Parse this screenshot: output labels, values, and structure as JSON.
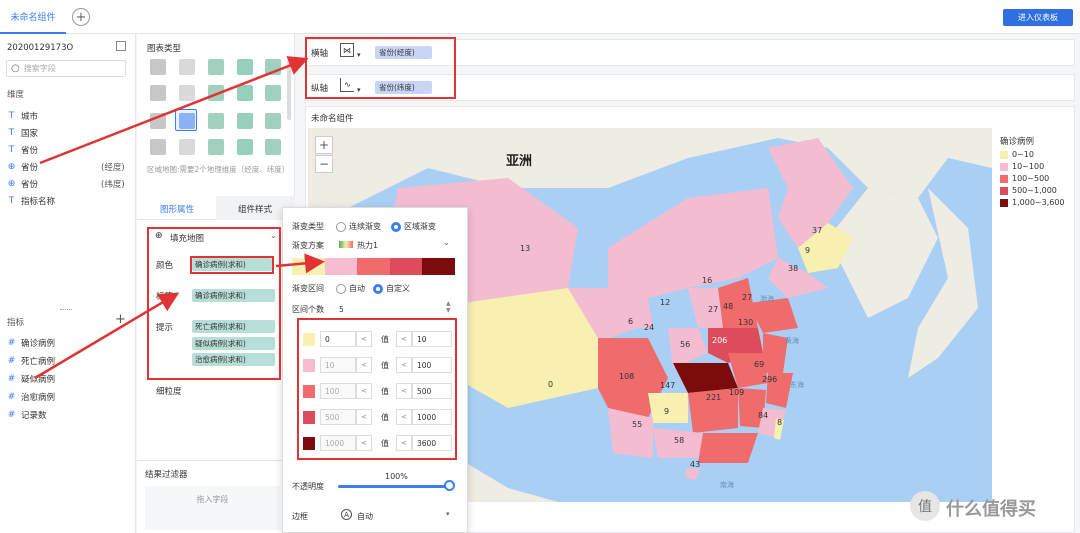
{
  "topbar": {
    "tab_label": "未命名组件",
    "add_tab": "+",
    "enter_dashboard": "进入仪表板"
  },
  "data_panel": {
    "dataset": "20200129173O",
    "search_placeholder": "搜索字段",
    "dimension_title": "维度",
    "dimensions": [
      {
        "icon": "T",
        "label": "城市",
        "suffix": ""
      },
      {
        "icon": "T",
        "label": "国家",
        "suffix": ""
      },
      {
        "icon": "T",
        "label": "省份",
        "suffix": ""
      },
      {
        "icon": "globe",
        "label": "省份",
        "suffix": "(经度)"
      },
      {
        "icon": "globe",
        "label": "省份",
        "suffix": "(纬度)"
      },
      {
        "icon": "T",
        "label": "指标名称",
        "suffix": ""
      }
    ],
    "metric_title": "指标",
    "metrics": [
      "确诊病例",
      "死亡病例",
      "疑似病例",
      "治愈病例",
      "记录数"
    ]
  },
  "chart_panel": {
    "title": "图表类型",
    "hint": "区域地图:需要2个地理维度（经度、纬度）",
    "tab_graphic": "图形属性",
    "tab_style": "组件样式",
    "map_type": "填充地图",
    "color_label": "颜色",
    "color_field": "确诊病例(求和)",
    "label_label": "标签",
    "label_field": "确诊病例(求和)",
    "tooltip_label": "提示",
    "tooltip_fields": [
      "死亡病例(求和)",
      "疑似病例(求和)",
      "治愈病例(求和)"
    ],
    "granularity": "细粒度",
    "filter_title": "结果过滤器",
    "filter_drop": "拖入字段"
  },
  "popup": {
    "gradient_type_label": "渐变类型",
    "opt_continuous": "连续渐变",
    "opt_region": "区域渐变",
    "scheme_label": "渐变方案",
    "scheme_value": "热力1",
    "scheme_colors": [
      "#f8f0b0",
      "#f7bcd0",
      "#f06c6c",
      "#dc4c5a",
      "#7c0c0c"
    ],
    "interval_label": "渐变区间",
    "opt_auto": "自动",
    "opt_custom": "自定义",
    "count_label": "区间个数",
    "count_value": "5",
    "value_label": "值",
    "less_op": "<",
    "ranges": [
      {
        "color": "#f8f0b0",
        "from": "0",
        "to": "10"
      },
      {
        "color": "#f7bcd0",
        "from": "10",
        "to": "100"
      },
      {
        "color": "#f06c6c",
        "from": "100",
        "to": "500"
      },
      {
        "color": "#dc4c5a",
        "from": "500",
        "to": "1000"
      },
      {
        "color": "#7c0c0c",
        "from": "1000",
        "to": "3600"
      }
    ],
    "opacity_label": "不透明度",
    "opacity_value": "100%",
    "opacity": 1.0,
    "border_label": "边框",
    "border_value": "自动"
  },
  "axes": {
    "x_label": "横轴",
    "x_field": "省份(经度)",
    "y_label": "纵轴",
    "y_field": "省份(纬度)"
  },
  "chart": {
    "title": "未命名组件",
    "continent": "亚洲",
    "zoom_in": "+",
    "zoom_out": "−",
    "legend_title": "确诊病例",
    "legend": [
      {
        "label": "0~10",
        "color": "#f8f0b0"
      },
      {
        "label": "10~100",
        "color": "#f7bcd0"
      },
      {
        "label": "100~500",
        "color": "#f06c6c"
      },
      {
        "label": "500~1,000",
        "color": "#dc4c5a"
      },
      {
        "label": "1,000~3,600",
        "color": "#7c0c0c"
      }
    ],
    "region_values": [
      "13",
      "37",
      "9",
      "38",
      "16",
      "27",
      "48",
      "12",
      "6",
      "24",
      "56",
      "130",
      "27",
      "206",
      "0",
      "108",
      "147",
      "69",
      "296",
      "9",
      "221",
      "109",
      "55",
      "84",
      "58",
      "8",
      "43"
    ],
    "seas": [
      "渤海",
      "黄海",
      "东海",
      "南海"
    ]
  },
  "watermark": "值 什么值得买"
}
